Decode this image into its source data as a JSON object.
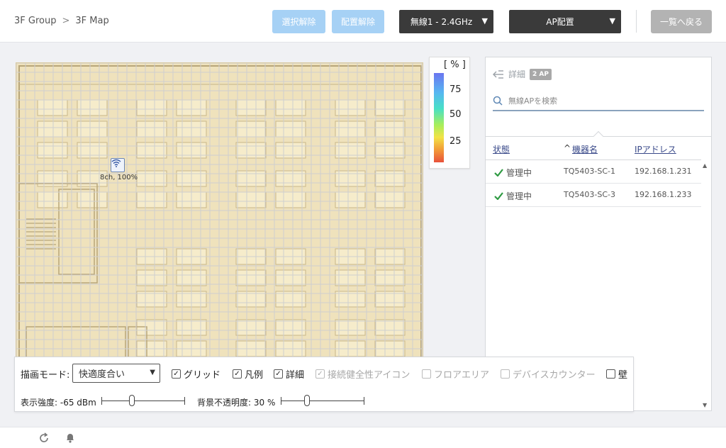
{
  "breadcrumb": {
    "group": "3F Group",
    "separator": ">",
    "map": "3F Map"
  },
  "toolbar": {
    "deselect_label": "選択解除",
    "unplace_label": "配置解除",
    "band_select": "無線1 - 2.4GHz",
    "mode_select": "AP配置",
    "back_label": "一覧へ戻る"
  },
  "map": {
    "ap_label": "8ch, 100%"
  },
  "legend": {
    "unit": "[ % ]",
    "ticks": [
      "75",
      "50",
      "25"
    ]
  },
  "panel": {
    "title": "詳細",
    "ap_count": "2 AP",
    "search_placeholder": "無線APを検索",
    "columns": {
      "status": "状態",
      "name": "機器名",
      "ip": "IPアドレス",
      "sort_indicator": "^"
    },
    "rows": [
      {
        "status": "管理中",
        "name": "TQ5403-SC-1",
        "ip": "192.168.1.231"
      },
      {
        "status": "管理中",
        "name": "TQ5403-SC-3",
        "ip": "192.168.1.233"
      }
    ]
  },
  "controls": {
    "draw_mode_label": "描画モード:",
    "draw_mode_value": "快適度合い",
    "grid": "グリッド",
    "legend": "凡例",
    "detail": "詳細",
    "health_icon": "接続健全性アイコン",
    "floor_area": "フロアエリア",
    "device_counter": "デバイスカウンター",
    "wall": "壁",
    "strength_label": "表示強度: -65 dBm",
    "opacity_label": "背景不透明度: 30 %",
    "strength_level": 0.35,
    "opacity_level": 0.3
  },
  "colors": {
    "accent_light": "#a6d1f5",
    "dark_button": "#3a3a3a",
    "map_floor": "#efe2bc",
    "status_ok": "#2e9a42"
  },
  "icons": {
    "back": "collapse-arrow-icon",
    "search": "search-icon",
    "ok": "checkmark-icon",
    "wifi": "wifi-icon",
    "refresh": "refresh-icon",
    "bell": "bell-icon"
  }
}
